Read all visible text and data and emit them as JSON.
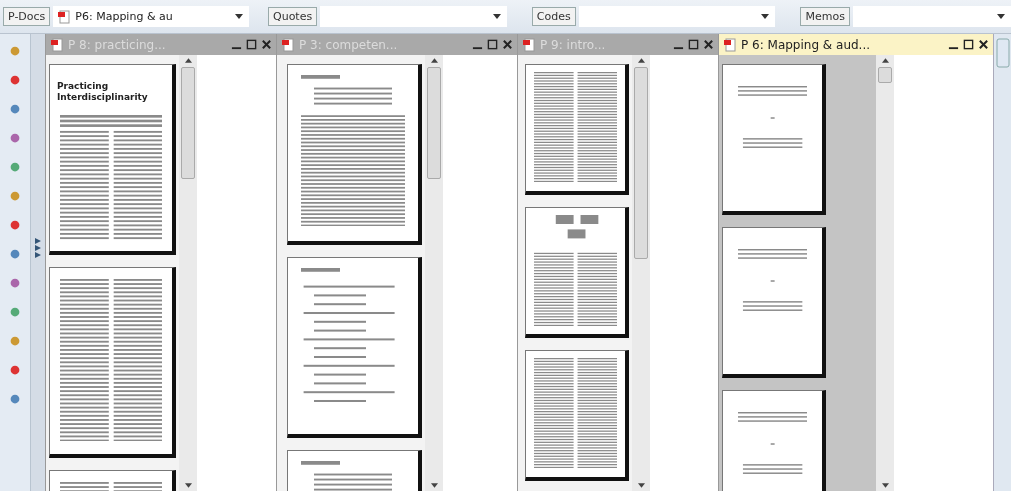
{
  "toolbar": [
    {
      "label": "P-Docs",
      "value": "P6: Mapping & au"
    },
    {
      "label": "Quotes"
    },
    {
      "label": "Codes"
    },
    {
      "label": "Memos"
    }
  ],
  "panes": [
    {
      "title": "P 8: practicing...",
      "active": false,
      "pages": [
        {
          "kind": "article",
          "title": "Practicing Interdisciplinarity"
        },
        {
          "kind": "columns"
        },
        {
          "kind": "columns"
        }
      ]
    },
    {
      "title": "P 3: competen...",
      "active": false,
      "pages": [
        {
          "kind": "paper"
        },
        {
          "kind": "list"
        },
        {
          "kind": "paper"
        }
      ]
    },
    {
      "title": "P 9: intro...",
      "active": false,
      "pages": [
        {
          "kind": "columns"
        },
        {
          "kind": "diagram"
        },
        {
          "kind": "columns"
        }
      ]
    },
    {
      "title": "P 6: Mapping & aud...",
      "active": true,
      "pages": [
        {
          "kind": "cover"
        },
        {
          "kind": "cover"
        },
        {
          "kind": "cover"
        }
      ]
    }
  ]
}
